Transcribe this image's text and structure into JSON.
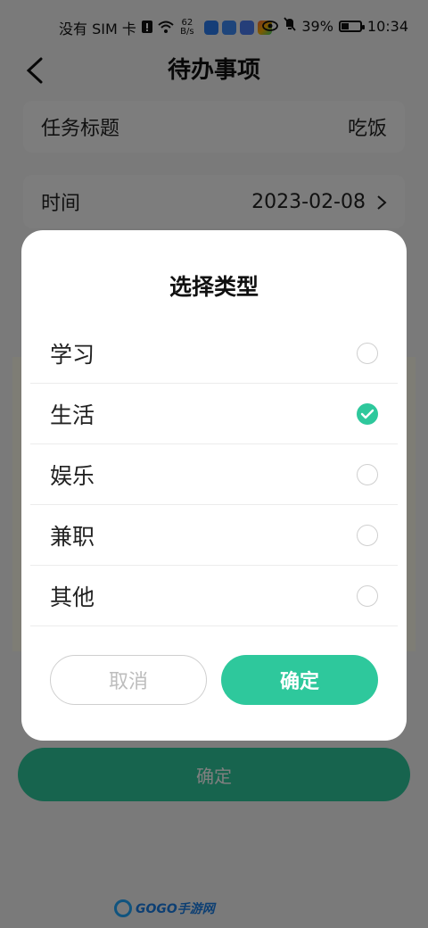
{
  "status_bar": {
    "carrier": "没有 SIM 卡",
    "speed_value": "62",
    "speed_unit": "B/s",
    "battery": "39%",
    "time": "10:34"
  },
  "header": {
    "title": "待办事项"
  },
  "form": {
    "title_label": "任务标题",
    "title_value": "吃饭",
    "time_label": "时间",
    "time_value": "2023-02-08"
  },
  "bottom_button": "确定",
  "dialog": {
    "title": "选择类型",
    "options": [
      {
        "label": "学习",
        "selected": false
      },
      {
        "label": "生活",
        "selected": true
      },
      {
        "label": "娱乐",
        "selected": false
      },
      {
        "label": "兼职",
        "selected": false
      },
      {
        "label": "其他",
        "selected": false
      }
    ],
    "cancel_label": "取消",
    "confirm_label": "确定"
  },
  "watermark": "GOGO手游网",
  "colors": {
    "accent": "#2ec89c",
    "overlay": "rgba(0,0,0,0.5)"
  }
}
